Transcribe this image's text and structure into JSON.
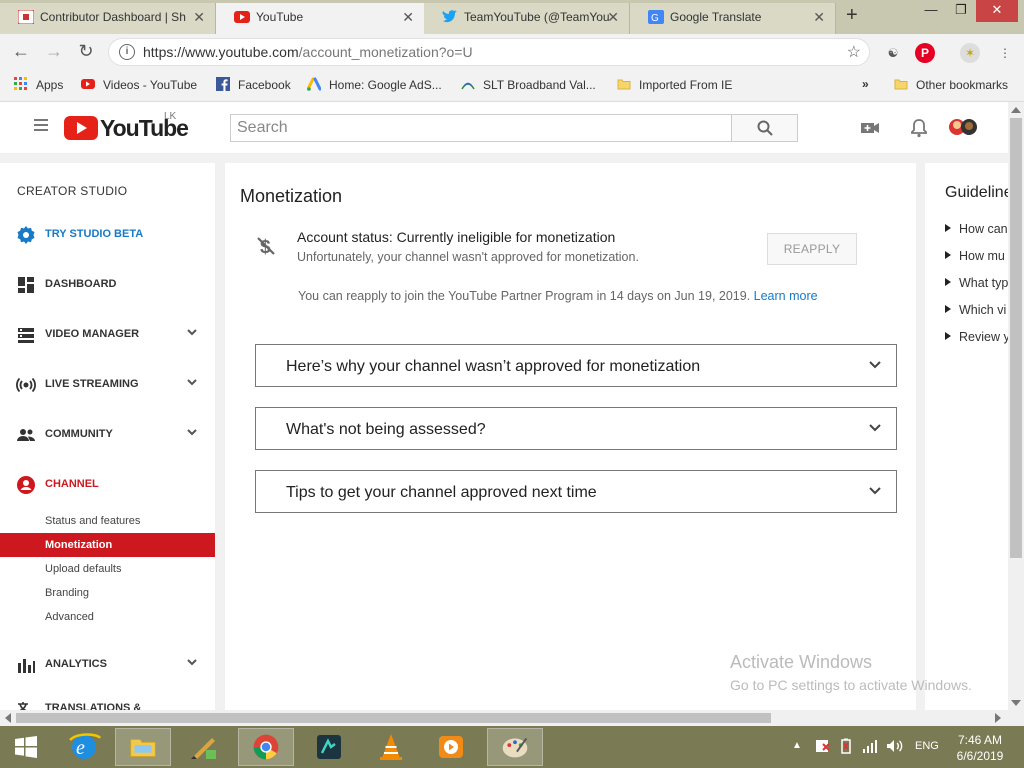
{
  "browser": {
    "tabs": [
      {
        "title": "Contributor Dashboard | Sh",
        "active": false
      },
      {
        "title": "YouTube",
        "active": true
      },
      {
        "title": "TeamYouTube (@TeamYou",
        "active": false
      },
      {
        "title": "Google Translate",
        "active": false
      }
    ],
    "tab_close_glyph": "✕",
    "new_tab_glyph": "+",
    "url_host": "https://www.youtube.com",
    "url_path": "/account_monetization?o=U",
    "bookmarks": [
      {
        "label": "Apps",
        "icon": "apps-grid-icon"
      },
      {
        "label": "Videos - YouTube",
        "icon": "youtube-icon"
      },
      {
        "label": "Facebook",
        "icon": "facebook-icon"
      },
      {
        "label": "Home: Google AdS...",
        "icon": "google-ads-icon"
      },
      {
        "label": "SLT Broadband Val...",
        "icon": "slt-icon"
      },
      {
        "label": "Imported From IE",
        "icon": "folder-icon"
      }
    ],
    "bookmarks_overflow": "»",
    "other_bookmarks": "Other bookmarks"
  },
  "youtube": {
    "logo_text": "YouTube",
    "country_code": "LK",
    "search_placeholder": "Search"
  },
  "sidebar": {
    "title": "CREATOR STUDIO",
    "items": [
      {
        "label": "TRY STUDIO BETA",
        "icon": "gear-icon",
        "color": "#167ac6"
      },
      {
        "label": "DASHBOARD",
        "icon": "dashboard-icon"
      },
      {
        "label": "VIDEO MANAGER",
        "icon": "video-manager-icon",
        "expandable": true
      },
      {
        "label": "LIVE STREAMING",
        "icon": "live-streaming-icon",
        "expandable": true
      },
      {
        "label": "COMMUNITY",
        "icon": "community-icon",
        "expandable": true
      },
      {
        "label": "CHANNEL",
        "icon": "channel-icon",
        "color": "#cc181e"
      },
      {
        "label": "ANALYTICS",
        "icon": "analytics-icon",
        "expandable": true
      },
      {
        "label": "TRANSLATIONS &",
        "icon": "translations-icon"
      }
    ],
    "channel_subitems": [
      {
        "label": "Status and features"
      },
      {
        "label": "Monetization",
        "active": true
      },
      {
        "label": "Upload defaults"
      },
      {
        "label": "Branding"
      },
      {
        "label": "Advanced"
      }
    ]
  },
  "main": {
    "title": "Monetization",
    "status_title": "Account status: Currently ineligible for monetization",
    "status_sub": "Unfortunately, your channel wasn't approved for monetization.",
    "reapply_button": "REAPPLY",
    "reapply_note": "You can reapply to join the YouTube Partner Program in 14 days on Jun 19, 2019.",
    "learn_more": "Learn more",
    "accordions": [
      {
        "label": "Here’s why your channel wasn’t approved for monetization"
      },
      {
        "label": "What's not being assessed?"
      },
      {
        "label": "Tips to get your channel approved next time"
      }
    ]
  },
  "guidelines": {
    "title": "Guidelines",
    "items": [
      "How can",
      "How mu",
      "What typ",
      "Which vi",
      "Review y"
    ]
  },
  "watermark": {
    "line1": "Activate Windows",
    "line2": "Go to PC settings to activate Windows."
  },
  "taskbar": {
    "language": "ENG",
    "time": "7:46 AM",
    "date": "6/6/2019"
  },
  "colors": {
    "youtube_red": "#e62117",
    "active_red": "#cc181e",
    "link_blue": "#167ac6"
  }
}
